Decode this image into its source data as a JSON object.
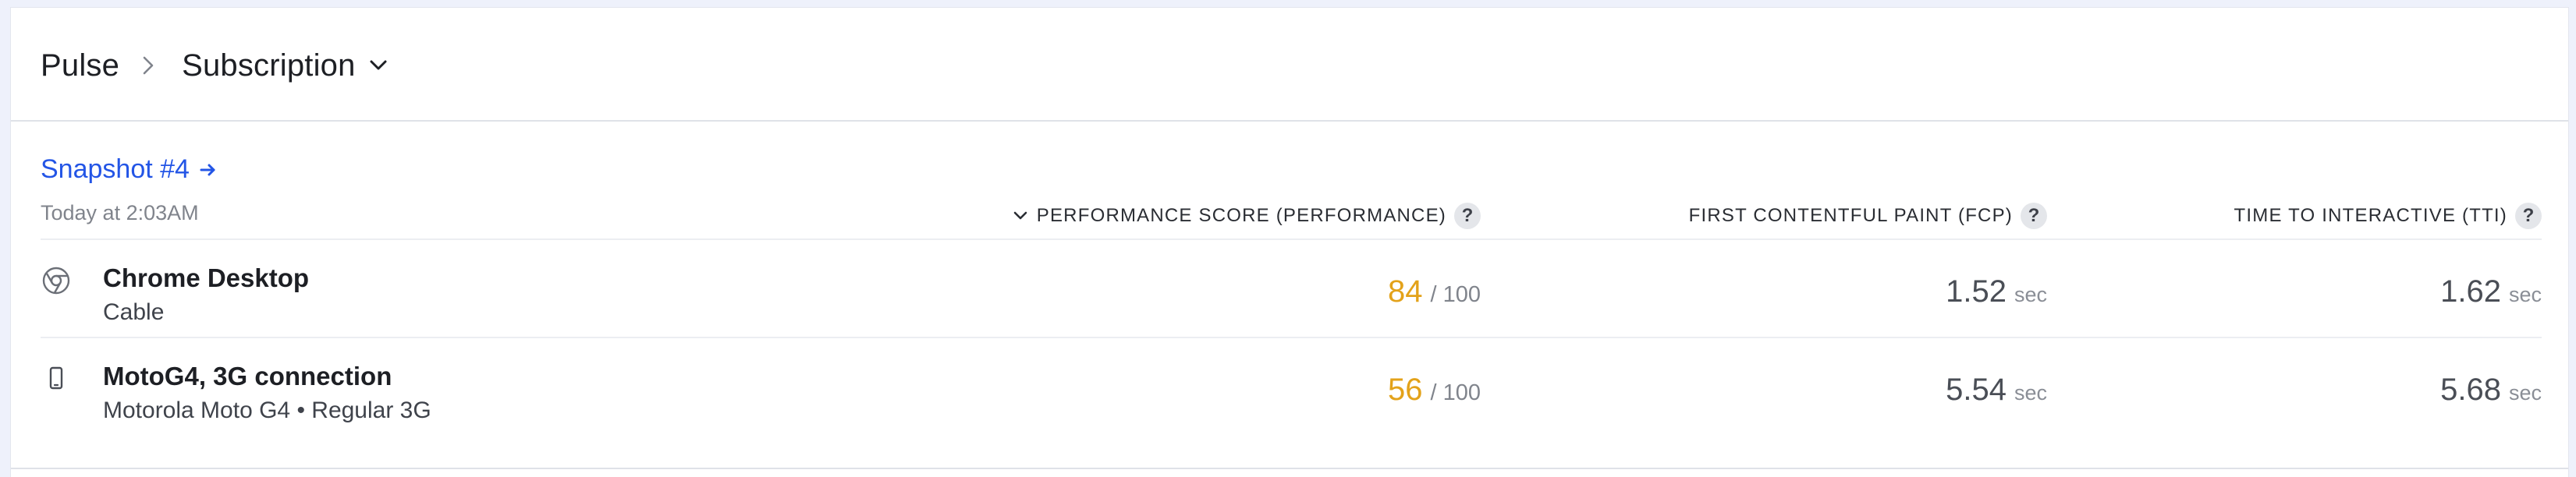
{
  "breadcrumb": {
    "root": "Pulse",
    "current": "Subscription"
  },
  "snapshot": {
    "title": "Snapshot #4",
    "time": "Today at 2:03AM"
  },
  "columns": {
    "performance": "PERFORMANCE SCORE (PERFORMANCE)",
    "fcp": "FIRST CONTENTFUL PAINT (FCP)",
    "tti": "TIME TO INTERACTIVE (TTI)",
    "help_glyph": "?"
  },
  "rows": [
    {
      "icon": "chrome-icon",
      "title": "Chrome Desktop",
      "subtitle": "Cable",
      "score": "84",
      "score_max": "/ 100",
      "fcp": "1.52",
      "fcp_unit": "sec",
      "tti": "1.62",
      "tti_unit": "sec"
    },
    {
      "icon": "mobile-phone-icon",
      "title": "MotoG4, 3G connection",
      "subtitle": "Motorola Moto G4 • Regular 3G",
      "score": "56",
      "score_max": "/ 100",
      "fcp": "5.54",
      "fcp_unit": "sec",
      "tti": "5.68",
      "tti_unit": "sec"
    }
  ],
  "colors": {
    "link": "#2355e6",
    "score": "#e3a21a",
    "background": "#eef1fb"
  }
}
